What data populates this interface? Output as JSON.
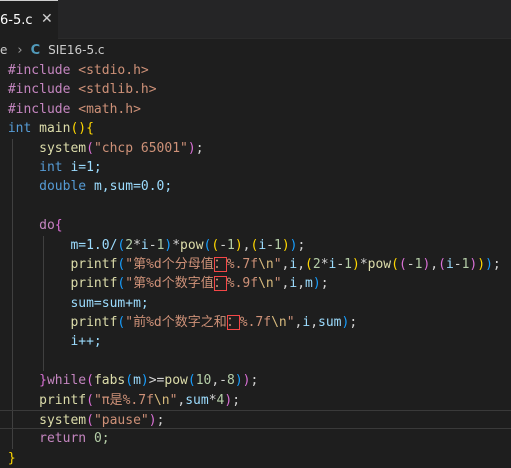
{
  "tab": {
    "title": "6-5.c",
    "close": "✕"
  },
  "breadcrumb": {
    "prefix": "e",
    "separator": "›",
    "lang_icon": "C",
    "file": "SIE16-5.c"
  },
  "colors": {
    "keyword": "#569cd6",
    "preprocessor": "#c586c0",
    "function": "#dcdcaa",
    "string": "#ce9178",
    "variable": "#9cdcfe",
    "number": "#b5cea8"
  },
  "code": {
    "inc1_dir": "#include",
    "inc1_hdr": "<stdio.h>",
    "inc2_dir": "#include",
    "inc2_hdr": "<stdlib.h>",
    "inc3_dir": "#include",
    "inc3_hdr": "<math.h>",
    "main_type": "int",
    "main_name": "main",
    "sys1_fn": "system",
    "sys1_arg": "\"chcp 65001\"",
    "decl_int": "int",
    "decl_int_rest": "i=1;",
    "decl_double": "double",
    "decl_double_rest": "m,sum=0.0;",
    "do_kw": "do",
    "m_assign": "m=1.0/",
    "printf": "printf",
    "p1_str_a": "\"第%d个分母值",
    "p1_colon": "：",
    "p1_str_b": "%.7f",
    "p1_esc": "\\n",
    "p1_str_c": "\"",
    "p2_str_a": "\"第%d个数字值",
    "p2_colon": "：",
    "p2_str_b": "%.9f",
    "p2_esc": "\\n",
    "p2_str_c": "\"",
    "sum_line": "sum=sum+m;",
    "p3_str_a": "\"前%d个数字之和",
    "p3_colon": "：",
    "p3_str_b": "%.7f",
    "p3_esc": "\\n",
    "p3_str_c": "\"",
    "inc_line": "i++;",
    "while_kw": "while",
    "fabs_fn": "fabs",
    "pow_fn": "pow",
    "p4_str": "\"π是%.7f",
    "p4_esc": "\\n",
    "p4_end": "\"",
    "sys2_fn": "system",
    "sys2_arg": "\"pause\"",
    "return_kw": "return",
    "return_val": "0;"
  }
}
